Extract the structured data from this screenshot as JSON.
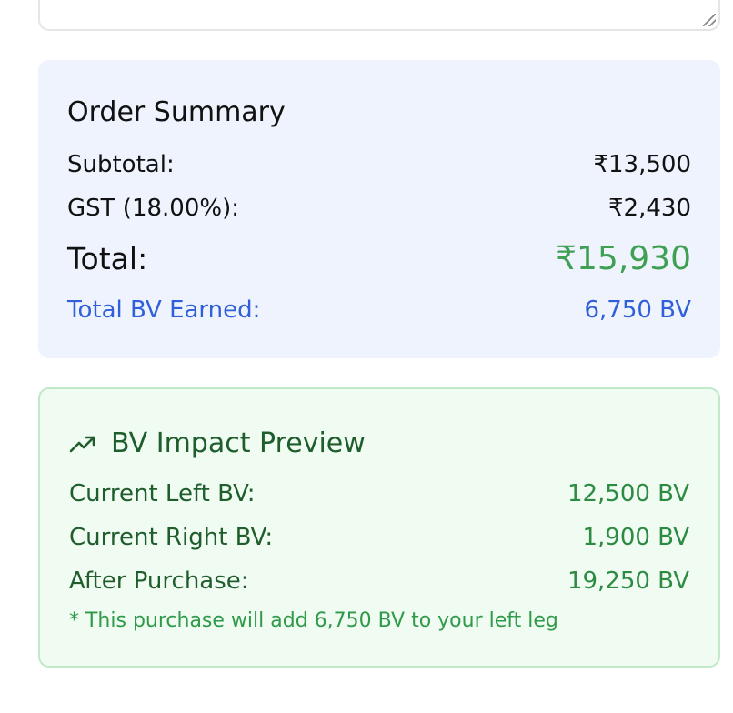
{
  "order_summary": {
    "title": "Order Summary",
    "subtotal_label": "Subtotal:",
    "subtotal_value": "₹13,500",
    "gst_label": "GST (18.00%):",
    "gst_value": "₹2,430",
    "total_label": "Total:",
    "total_value": "₹15,930",
    "bv_label": "Total BV Earned:",
    "bv_value": "6,750 BV"
  },
  "bv_impact": {
    "icon": "trending-up-icon",
    "title": "BV Impact Preview",
    "left_label": "Current Left BV:",
    "left_value": "12,500 BV",
    "right_label": "Current Right BV:",
    "right_value": "1,900 BV",
    "after_label": "After Purchase:",
    "after_value": "19,250 BV",
    "note": "* This purchase will add 6,750 BV to your left leg"
  },
  "colors": {
    "summary_bg": "#eef3fd",
    "total_green": "#3f9f53",
    "bv_blue": "#2f5fd9",
    "impact_bg": "#f0fbf2",
    "impact_border": "#bfe9c8",
    "impact_text": "#1f5e2c"
  }
}
